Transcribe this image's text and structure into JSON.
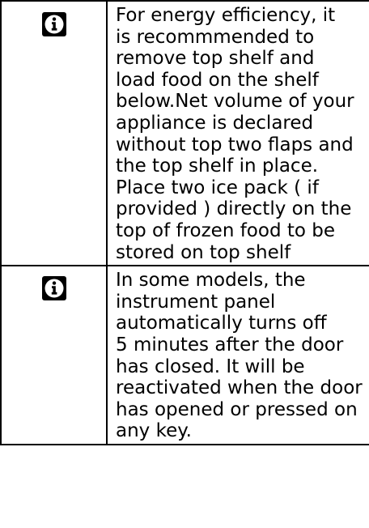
{
  "notes": [
    {
      "icon": "info-icon",
      "text": "For energy efficiency, it\nis recommmended to\nremove top shelf and\nload food on the shelf\nbelow.Net volume of your\nappliance is declared\nwithout top two flaps and\nthe top shelf in place.\nPlace two ice pack ( if\nprovided ) directly on the\ntop of frozen food to be\nstored on top shelf"
    },
    {
      "icon": "info-icon",
      "text": "In some models, the\ninstrument panel\nautomatically turns off\n5 minutes after the door\nhas closed. It will be\nreactivated when the door\nhas opened or pressed on\nany key."
    }
  ]
}
